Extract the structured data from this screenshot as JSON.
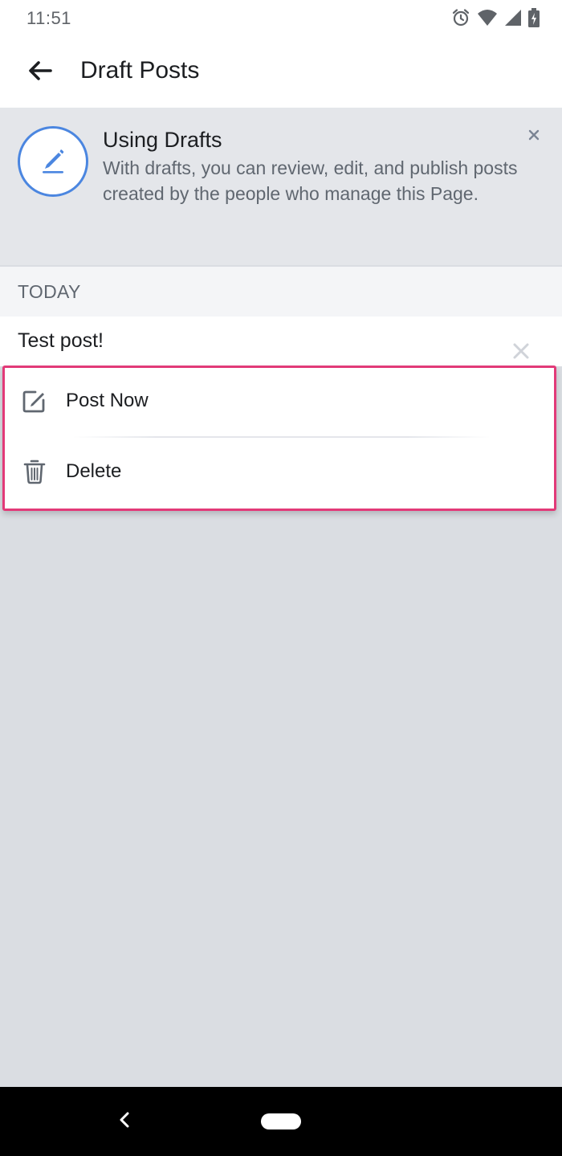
{
  "status_bar": {
    "time": "11:51",
    "icons": [
      "alarm-icon",
      "wifi-icon",
      "signal-icon",
      "battery-icon"
    ]
  },
  "app_bar": {
    "back_icon": "arrow-left-icon",
    "title": "Draft Posts"
  },
  "info_banner": {
    "icon": "pencil-icon",
    "title": "Using Drafts",
    "description": "With drafts, you can review, edit, and publish posts created by the people who manage this Page.",
    "close_icon": "close-icon"
  },
  "drafts_section": {
    "header": "TODAY",
    "post": {
      "text": "Test post!"
    }
  },
  "action_menu": {
    "items": [
      {
        "label": "Post Now",
        "icon": "compose-icon"
      },
      {
        "label": "Delete",
        "icon": "trash-icon"
      }
    ]
  },
  "nav_bar": {
    "back_icon": "nav-back-icon",
    "home_icon": "home-pill-icon"
  },
  "colors": {
    "accent_blue": "#4b86e0",
    "highlight_pink": "#e23a78",
    "background": "#dadde2"
  }
}
